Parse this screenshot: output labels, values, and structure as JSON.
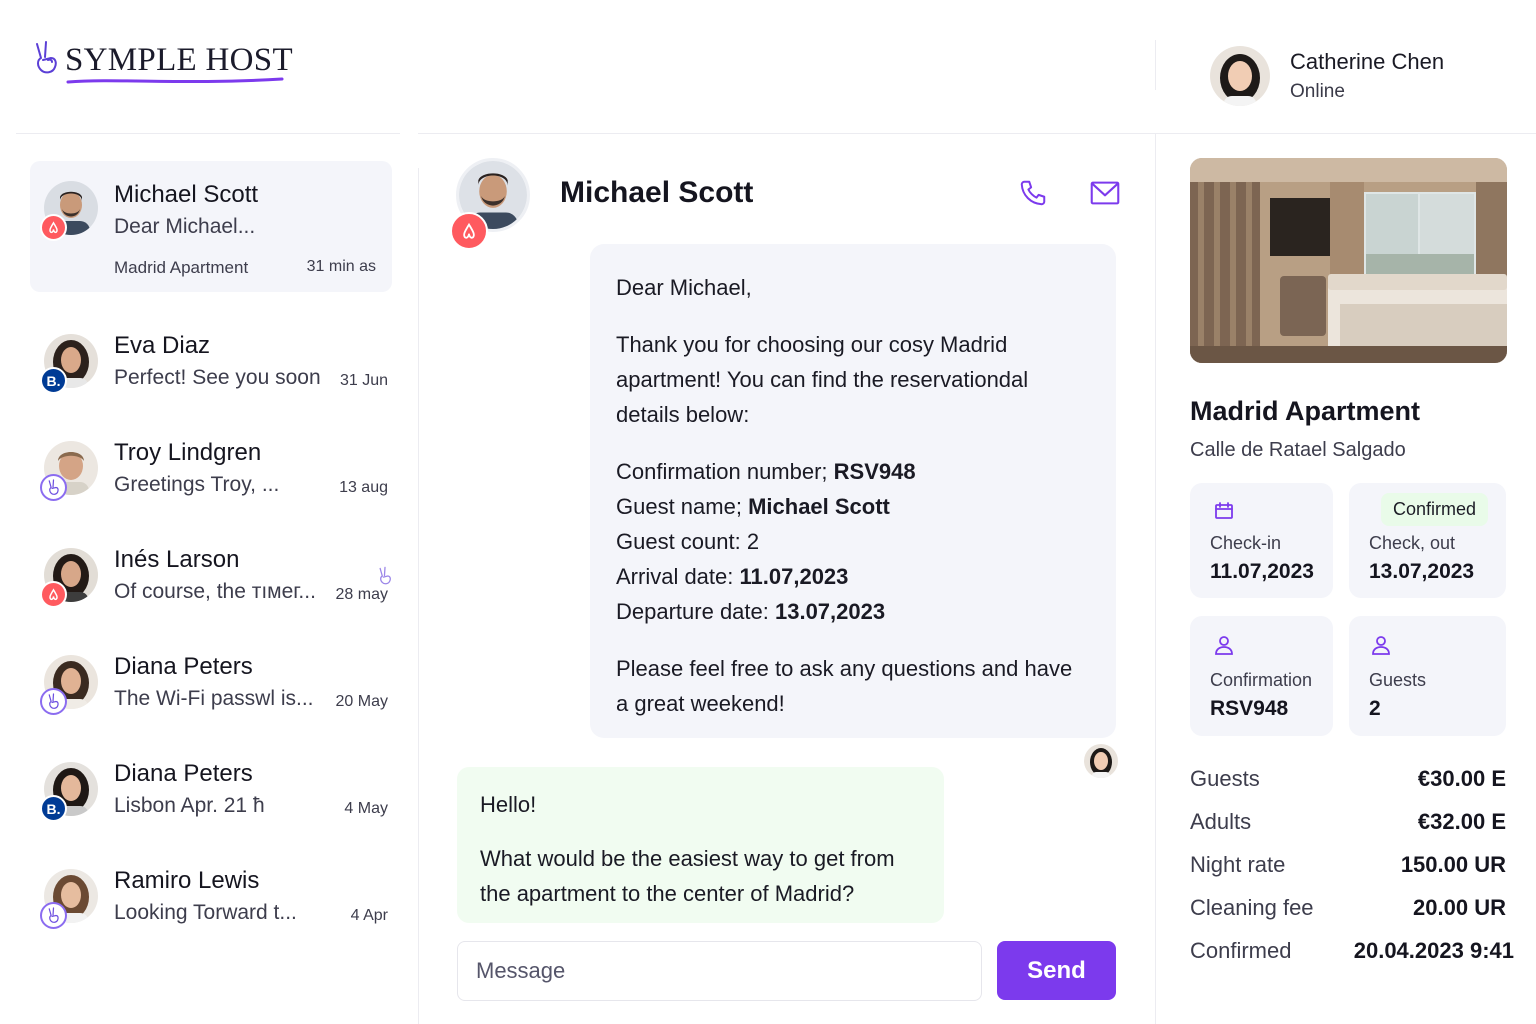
{
  "app": {
    "logo_text": "SYMPLE HOST"
  },
  "user": {
    "name": "Catherine Chen",
    "status": "Online"
  },
  "conversations": [
    {
      "name": "Michael Scott",
      "preview": "Dear Michael...",
      "subtitle": "Madrid Apartment",
      "time": "31 min as",
      "source": "airbnb",
      "active": true
    },
    {
      "name": "Eva Diaz",
      "preview": "Perfect! See you soon",
      "time": "31 Jun",
      "source": "booking"
    },
    {
      "name": "Troy Lindgren",
      "preview": "Greetings Troy, ...",
      "time": "13 aug",
      "source": "symple"
    },
    {
      "name": "Inés Larson",
      "preview": "Of course, the тıмeг...",
      "time": "28 may",
      "source": "airbnb"
    },
    {
      "name": "Diana Peters",
      "preview": "The Wi-Fi passwl is...",
      "time": "20 May",
      "source": "symple"
    },
    {
      "name": "Diana Peters",
      "preview": "Lisbon Apr. 21 ħ",
      "time": "4 May",
      "source": "booking"
    },
    {
      "name": "Ramiro Lewis",
      "preview": "Looking Torward t...",
      "time": "4 Apr",
      "source": "symple"
    }
  ],
  "badges": {
    "booking_letter": "B."
  },
  "chat": {
    "contact_name": "Michael Scott",
    "outgoing": {
      "greeting": "Dear Michael,",
      "intro": "Thank you for choosing our cosy Madrid apartment! You can find the reservationdal details below:",
      "details": [
        {
          "label": "Confirmation number; ",
          "value": "RSV948"
        },
        {
          "label": "Guest name; ",
          "value": "Michael Scott"
        },
        {
          "label": "Guest count: 2",
          "value": ""
        },
        {
          "label": "Arrival date: ",
          "value": "11.07,2023"
        },
        {
          "label": "Departure date: ",
          "value": "13.07,2023"
        }
      ],
      "closing": "Please feel free to ask any questions and have a great weekend!"
    },
    "incoming": {
      "greeting": "Hello!",
      "text": "What would be the easiest way to get from the apartment to the center of Madrid?"
    },
    "composer": {
      "placeholder": "Message",
      "send_label": "Send"
    }
  },
  "property": {
    "title": "Madrid Apartment",
    "address": "Calle de Ratael Salgado",
    "cards": {
      "checkin": {
        "label": "Check-in",
        "value": "11.07,2023"
      },
      "checkout": {
        "chip": "Confirmed",
        "label": "Check, out",
        "value": "13.07,2023"
      },
      "confirmation": {
        "label": "Confirmation",
        "value": "RSV948"
      },
      "guests": {
        "label": "Guests",
        "value": "2"
      }
    },
    "fees": [
      {
        "label": "Guests",
        "value": "€30.00 E"
      },
      {
        "label": "Adults",
        "value": "€32.00 E"
      },
      {
        "label": "Night rate",
        "value": "150.00 UR"
      },
      {
        "label": "Cleaning fee",
        "value": "20.00 UR"
      },
      {
        "label": "Confirmed",
        "value": "20.04.2023 9:41"
      }
    ]
  },
  "colors": {
    "accent": "#7c3aed",
    "airbnb": "#ff5a5f",
    "booking": "#003b95",
    "incoming_bubble": "#f1fcf1",
    "outgoing_bubble": "#f4f5fa",
    "chip_confirmed": "#e9fbe9"
  },
  "icons": {
    "call": "phone-icon",
    "email": "mail-icon",
    "checkin": "calendar-icon",
    "person": "person-icon",
    "logo": "peace-hand-icon"
  }
}
